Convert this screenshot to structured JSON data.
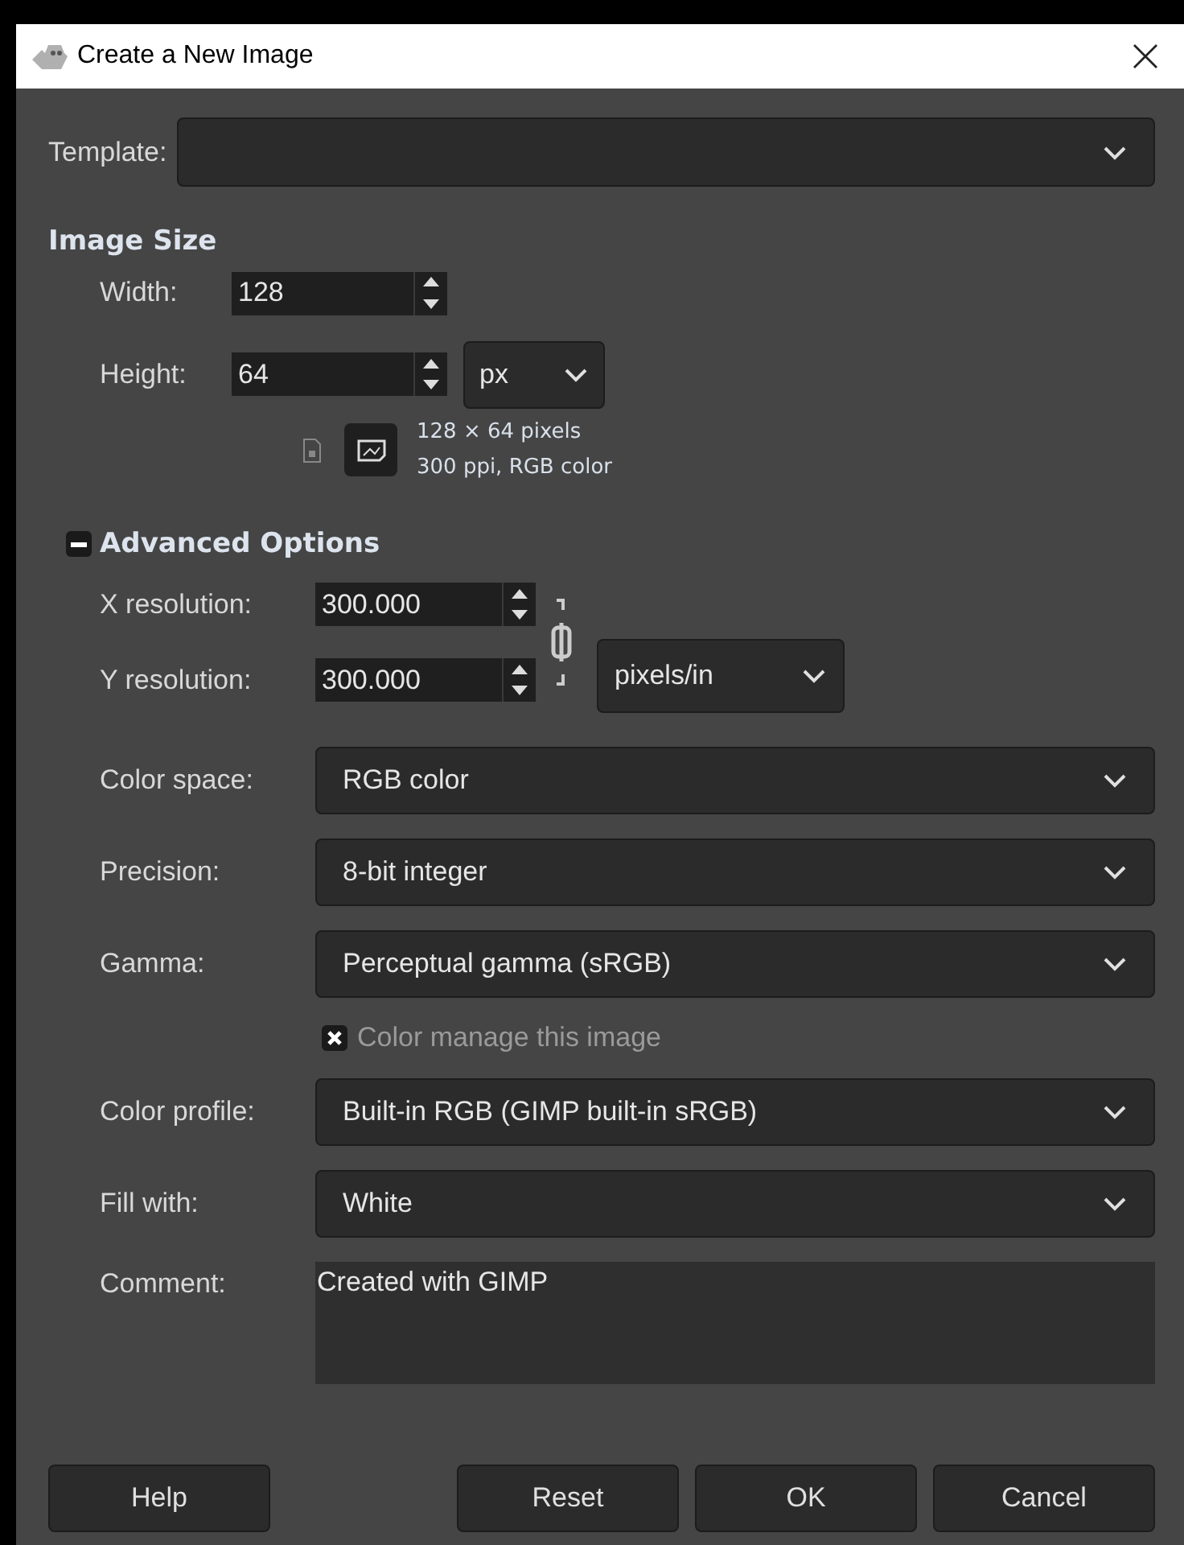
{
  "window": {
    "title": "Create a New Image"
  },
  "template": {
    "label": "Template:"
  },
  "image_size": {
    "heading": "Image Size",
    "width": {
      "label": "Width:",
      "value": "128"
    },
    "height": {
      "label": "Height:",
      "value": "64"
    },
    "unit": "px",
    "orientation_buttons": [
      {
        "kind": "portrait",
        "selected": false
      },
      {
        "kind": "landscape",
        "selected": true
      }
    ],
    "info": [
      "128 × 64 pixels",
      "300 ppi, RGB color"
    ]
  },
  "advanced": {
    "heading": "Advanced Options",
    "expanded": true,
    "x_resolution": {
      "label": "X resolution:",
      "value": "300.000"
    },
    "y_resolution": {
      "label": "Y resolution:",
      "value": "300.000"
    },
    "chain_linked": true,
    "resolution_unit": "pixels/in",
    "rows": [
      {
        "kind": "dropdown",
        "label": "Color space:",
        "value": "RGB color"
      },
      {
        "kind": "dropdown",
        "label": "Precision:",
        "value": "8-bit integer"
      },
      {
        "kind": "dropdown",
        "label": "Gamma:",
        "value": "Perceptual gamma (sRGB)"
      },
      {
        "kind": "checkbox",
        "label": "Color manage this image",
        "checked": true,
        "disabled": true
      },
      {
        "kind": "dropdown",
        "label": "Color profile:",
        "value": "Built-in RGB (GIMP built-in sRGB)"
      },
      {
        "kind": "dropdown",
        "label": "Fill with:",
        "value": "White"
      },
      {
        "kind": "textarea",
        "label": "Comment:",
        "value": "Created with GIMP"
      }
    ]
  },
  "help_button": "Help",
  "buttons": [
    "Reset",
    "OK",
    "Cancel"
  ]
}
